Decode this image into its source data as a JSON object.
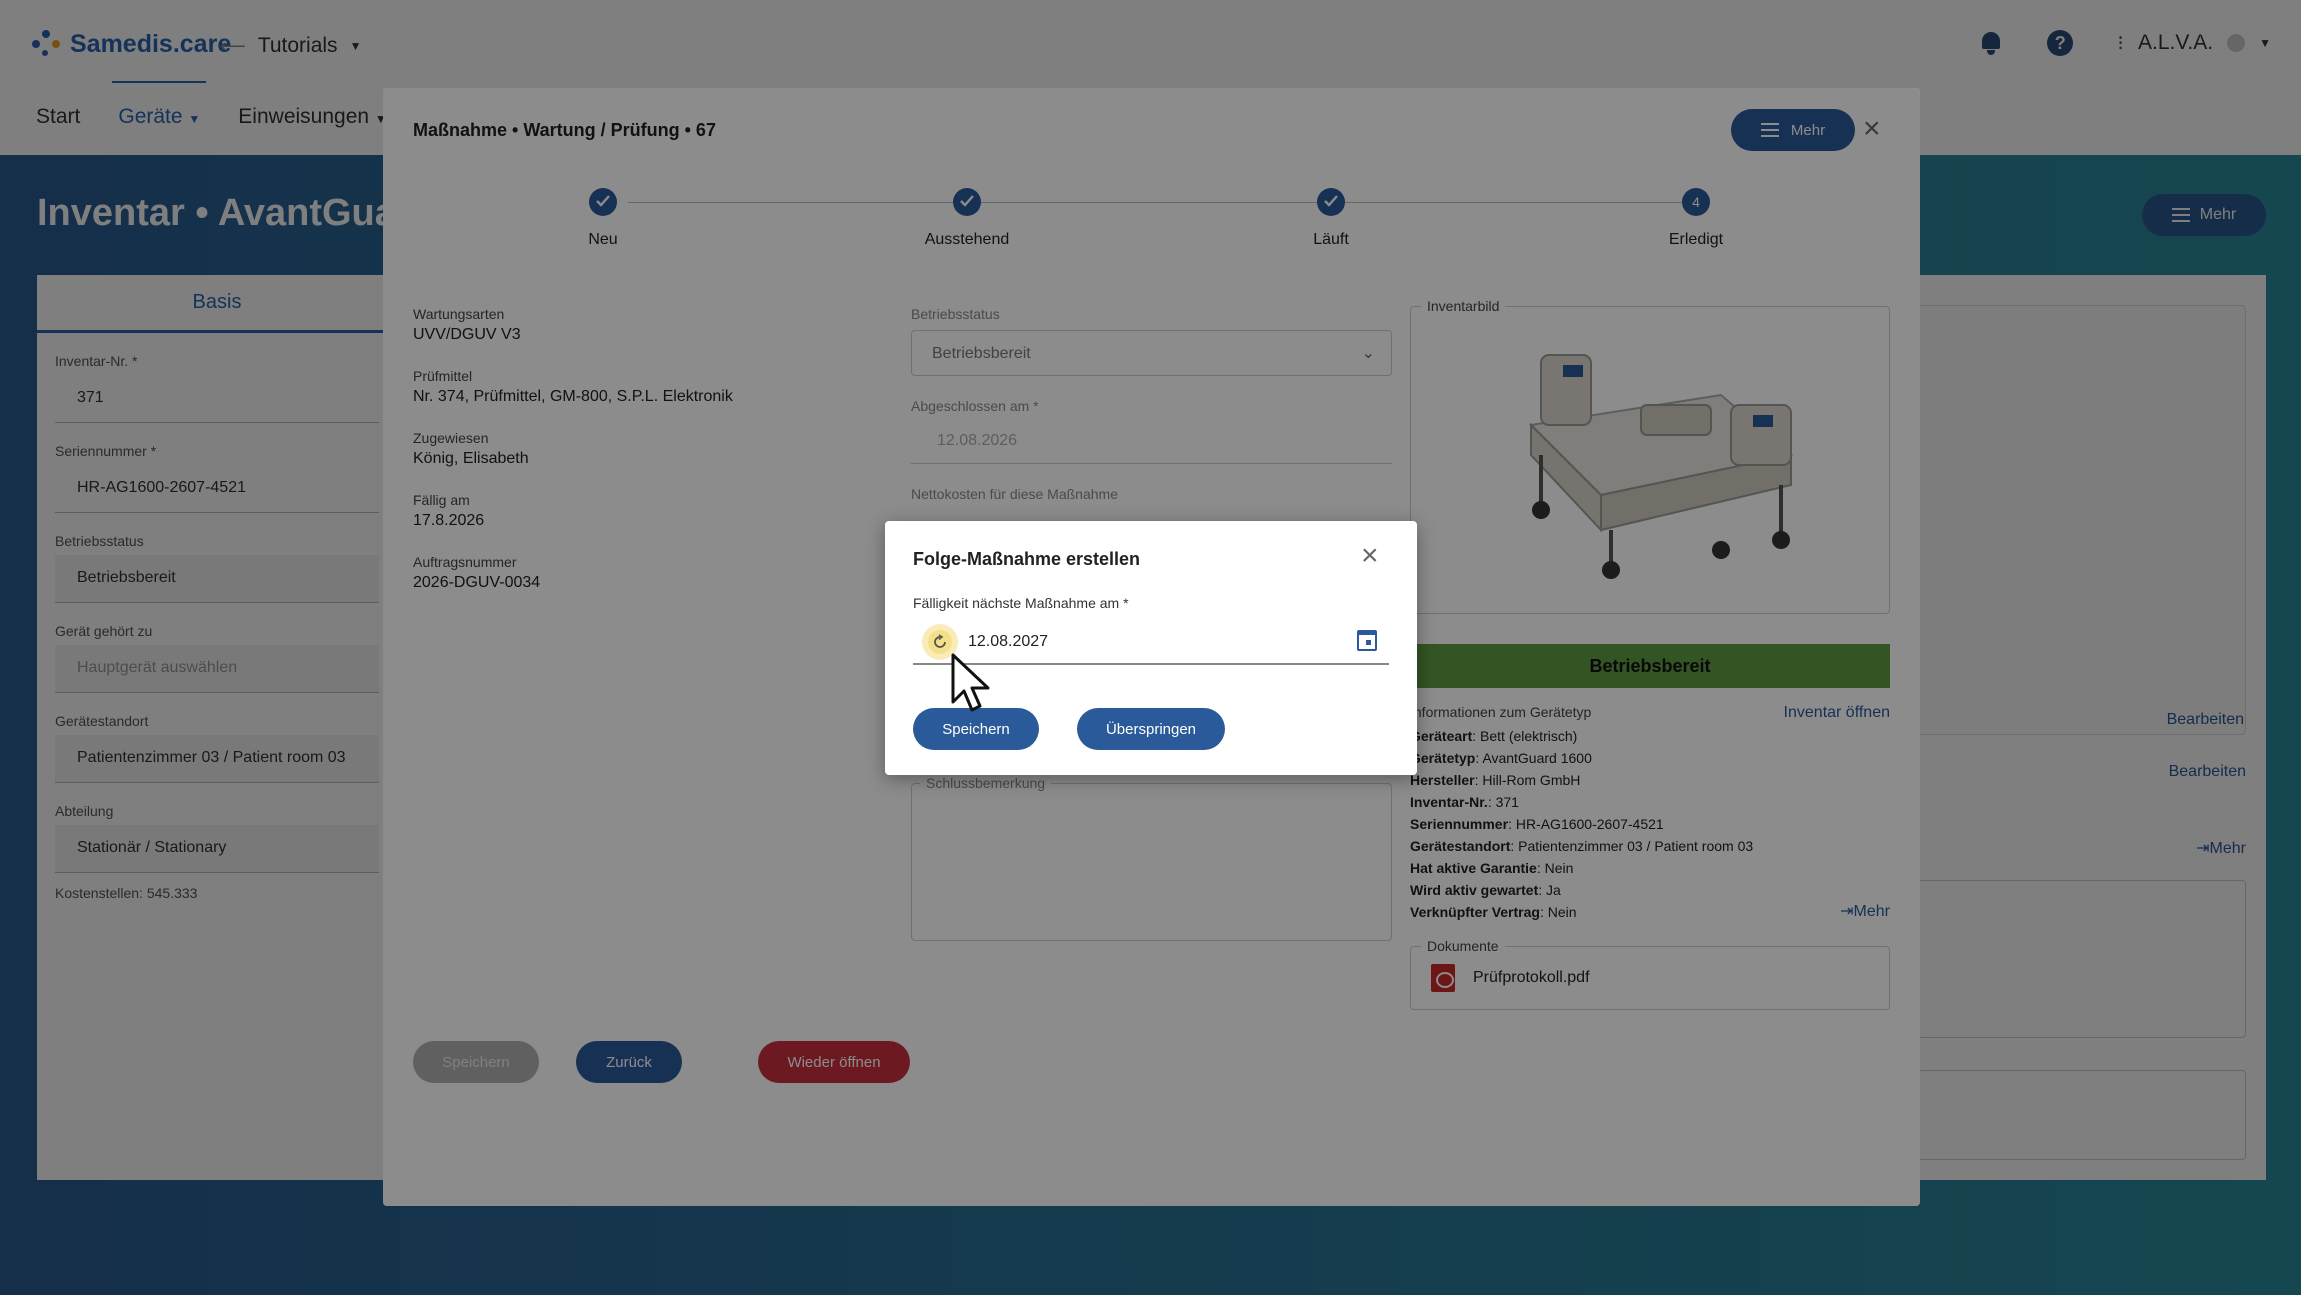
{
  "app": {
    "brand": "Samedis.care",
    "environment": "Tutorials",
    "user": "A.L.V.A.",
    "help_icon_glyph": "?",
    "nav": [
      "Start",
      "Geräte",
      "Einweisungen"
    ]
  },
  "background_page": {
    "title": "Inventar • AvantGuard",
    "mehr_label": "Mehr",
    "tab": "Basis",
    "fields": [
      {
        "label": "Inventar-Nr. *",
        "value": "371"
      },
      {
        "label": "Seriennummer *",
        "value": "HR-AG1600-2607-4521"
      },
      {
        "label": "Betriebsstatus",
        "value": "Betriebsbereit"
      },
      {
        "label": "Gerät gehört zu",
        "value": "Hauptgerät auswählen"
      },
      {
        "label": "Gerätestandort",
        "value": "Patientenzimmer 03 / Patient room 03"
      },
      {
        "label": "Abteilung",
        "value": "Stationär / Stationary"
      }
    ],
    "kostenstellen": "Kostenstellen: 545.333",
    "right_links": {
      "bearbeiten": "Bearbeiten",
      "mehr": "⇥Mehr"
    }
  },
  "modal": {
    "title": "Maßnahme • Wartung / Prüfung • 67",
    "mehr_label": "Mehr",
    "steps": [
      {
        "label": "Neu",
        "state": "done"
      },
      {
        "label": "Ausstehend",
        "state": "done"
      },
      {
        "label": "Läuft",
        "state": "done"
      },
      {
        "label": "Erledigt",
        "state": "current",
        "number": "4"
      }
    ],
    "info": [
      {
        "label": "Wartungsarten",
        "value": "UVV/DGUV V3"
      },
      {
        "label": "Prüfmittel",
        "value": "Nr. 374, Prüfmittel, GM-800, S.P.L. Elektronik"
      },
      {
        "label": "Zugewiesen",
        "value": "König, Elisabeth"
      },
      {
        "label": "Fällig am",
        "value": "17.8.2026"
      },
      {
        "label": "Auftragsnummer",
        "value": "2026-DGUV-0034"
      }
    ],
    "betriebsstatus_label": "Betriebsstatus",
    "betriebsstatus_value": "Betriebsbereit",
    "abgeschlossen_label": "Abgeschlossen am *",
    "abgeschlossen_value": "12.08.2026",
    "nettokosten_label": "Nettokosten für diese Maßnahme",
    "schluss_label": "Schlussbemerkung",
    "inventarbild_label": "Inventarbild",
    "status_bar": "Betriebsbereit",
    "device_info_head": "Informationen zum Gerätetyp",
    "inventar_oeffnen": "Inventar öffnen",
    "device_info": [
      {
        "key": "Geräteart",
        "value": "Bett (elektrisch)"
      },
      {
        "key": "Gerätetyp",
        "value": "AvantGuard 1600"
      },
      {
        "key": "Hersteller",
        "value": "Hill-Rom GmbH"
      },
      {
        "key": "Inventar-Nr.",
        "value": "371"
      },
      {
        "key": "Seriennummer",
        "value": "HR-AG1600-2607-4521"
      },
      {
        "key": "Gerätestandort",
        "value": "Patientenzimmer 03 / Patient room 03"
      },
      {
        "key": "Hat aktive Garantie",
        "value": "Nein"
      },
      {
        "key": "Wird aktiv gewartet",
        "value": "Ja"
      },
      {
        "key": "Verknüpfter Vertrag",
        "value": "Nein"
      }
    ],
    "device_mehr": "⇥Mehr",
    "dokumente_label": "Dokumente",
    "document": "Prüfprotokoll.pdf",
    "buttons": {
      "speichern": "Speichern",
      "zurueck": "Zurück",
      "wieder_oeffnen": "Wieder öffnen"
    }
  },
  "dialog": {
    "title": "Folge-Maßnahme erstellen",
    "field_label": "Fälligkeit nächste Maßnahme am *",
    "field_value": "12.08.2027",
    "buttons": {
      "speichern": "Speichern",
      "ueberspringen": "Überspringen"
    }
  },
  "colors": {
    "primary": "#2a5a9a",
    "danger": "#c62f3f",
    "success": "#5e9b43"
  }
}
